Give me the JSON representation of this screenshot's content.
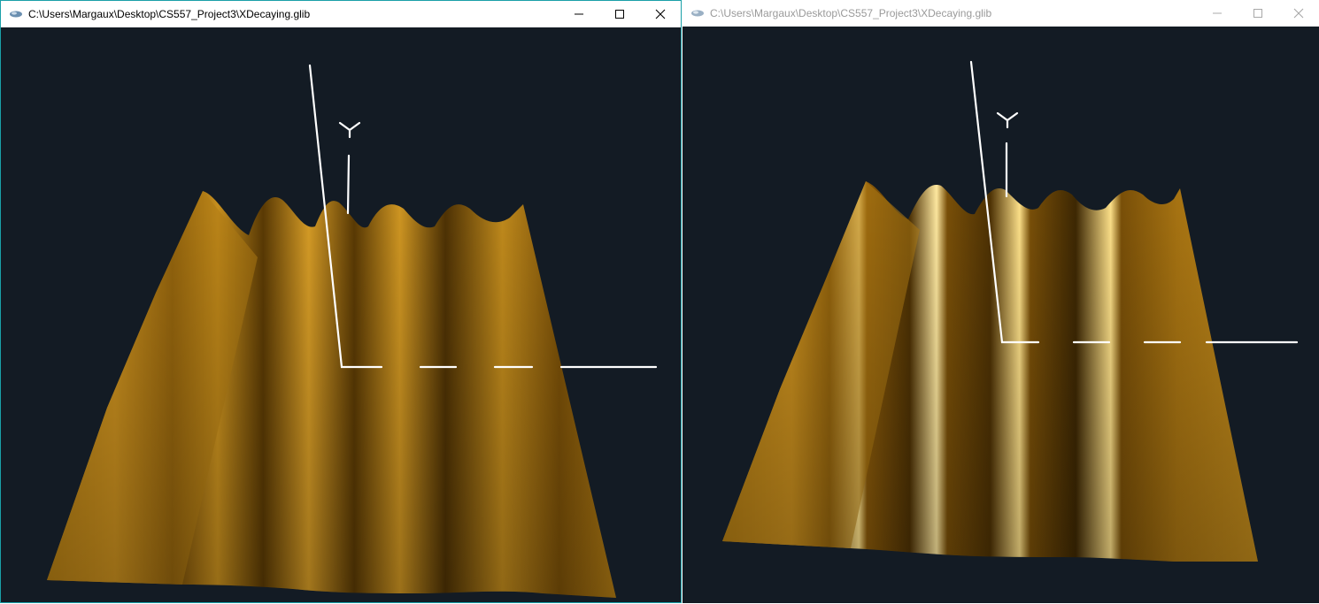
{
  "windows": [
    {
      "id": "left",
      "title": "C:\\Users\\Margaux\\Desktop\\CS557_Project3\\XDecaying.glib",
      "active": true,
      "controls": {
        "minimize": "minimize-icon",
        "maximize": "maximize-icon",
        "close": "close-icon"
      },
      "axis_label": "Y"
    },
    {
      "id": "right",
      "title": "C:\\Users\\Margaux\\Desktop\\CS557_Project3\\XDecaying.glib",
      "active": false,
      "controls": {
        "minimize": "minimize-icon",
        "maximize": "maximize-icon",
        "close": "close-icon"
      },
      "axis_label": "Y"
    }
  ],
  "colors": {
    "background": "#131b24",
    "surface": "#c08a1c",
    "surface_dark": "#5a3a04",
    "highlight": "#ffe28a",
    "axes": "#ffffff"
  }
}
